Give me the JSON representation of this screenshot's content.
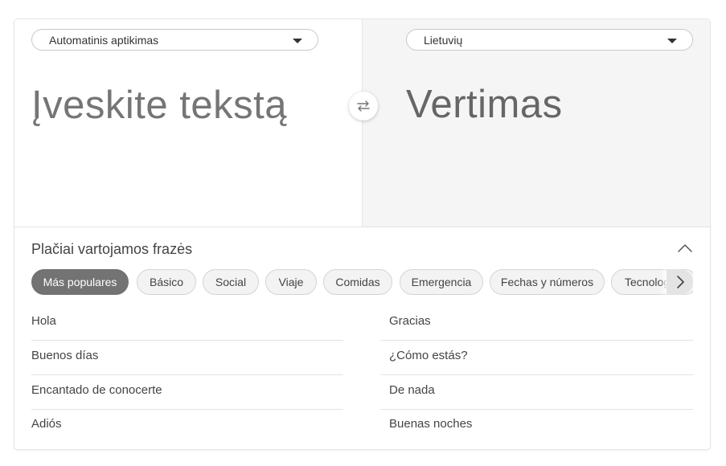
{
  "translator": {
    "source_language": "Automatinis aptikimas",
    "target_language": "Lietuvių",
    "source_placeholder": "Įveskite tekstą",
    "target_placeholder": "Vertimas"
  },
  "phrases": {
    "title": "Plačiai vartojamos frazės",
    "categories": [
      "Más populares",
      "Básico",
      "Social",
      "Viaje",
      "Comidas",
      "Emergencia",
      "Fechas y números",
      "Tecnología"
    ],
    "active_category": "Más populares",
    "left_column": [
      "Hola",
      "Buenos días",
      "Encantado de conocerte",
      "Adiós"
    ],
    "right_column": [
      "Gracias",
      "¿Cómo estás?",
      "De nada",
      "Buenas noches"
    ]
  },
  "icons": {
    "swap": "swap-arrows-icon",
    "collapse": "chevron-up-icon",
    "next": "chevron-right-icon",
    "dropdown": "caret-down-icon"
  },
  "colors": {
    "active_chip": "#737373",
    "chip_bg": "#f3f3f3",
    "target_pane_bg": "#f5f5f5",
    "text": "#444444"
  }
}
